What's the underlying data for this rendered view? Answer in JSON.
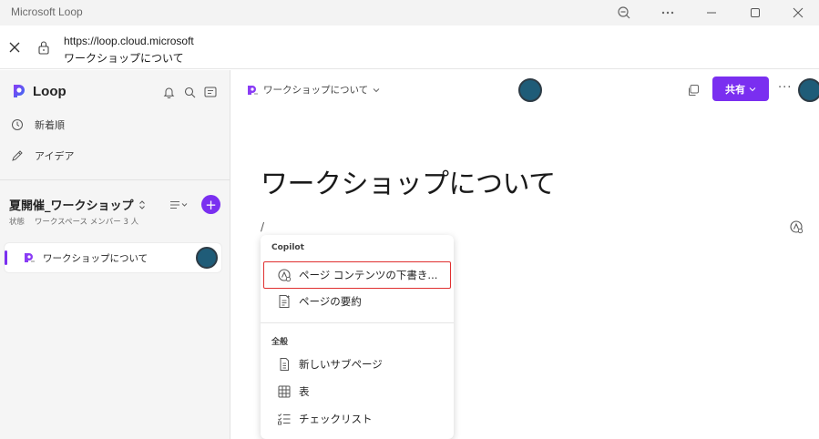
{
  "titlebar": {
    "title": "Microsoft Loop"
  },
  "address": {
    "url": "https://loop.cloud.microsoft",
    "page_title": "ワークショップについて"
  },
  "sidebar": {
    "app_name": "Loop",
    "nav": [
      {
        "label": "新着順",
        "icon": "clock-icon"
      },
      {
        "label": "アイデア",
        "icon": "pen-icon"
      }
    ],
    "workspace": {
      "name": "夏開催_ワークショップ",
      "status": "状態",
      "members": "ワークスペース メンバー 3 人",
      "add_symbol": "+"
    },
    "pages": [
      {
        "label": "ワークショップについて"
      }
    ]
  },
  "main": {
    "breadcrumb": "ワークショップについて",
    "share_label": "共有",
    "more_label": "···",
    "doc_title": "ワークショップについて",
    "slash": "/"
  },
  "menu": {
    "copilot_label": "Copilot",
    "copilot_items": [
      {
        "label": "ページ コンテンツの下書き...",
        "icon": "copilot-draft-icon"
      },
      {
        "label": "ページの要約",
        "icon": "summary-icon"
      }
    ],
    "general_label": "全般",
    "general_items": [
      {
        "label": "新しいサブページ",
        "icon": "subpage-icon"
      },
      {
        "label": "表",
        "icon": "table-icon"
      },
      {
        "label": "チェックリスト",
        "icon": "checklist-icon"
      }
    ]
  },
  "colors": {
    "accent": "#7a2ff0",
    "highlight_border": "#e03030",
    "avatar": "#1f5c78"
  }
}
